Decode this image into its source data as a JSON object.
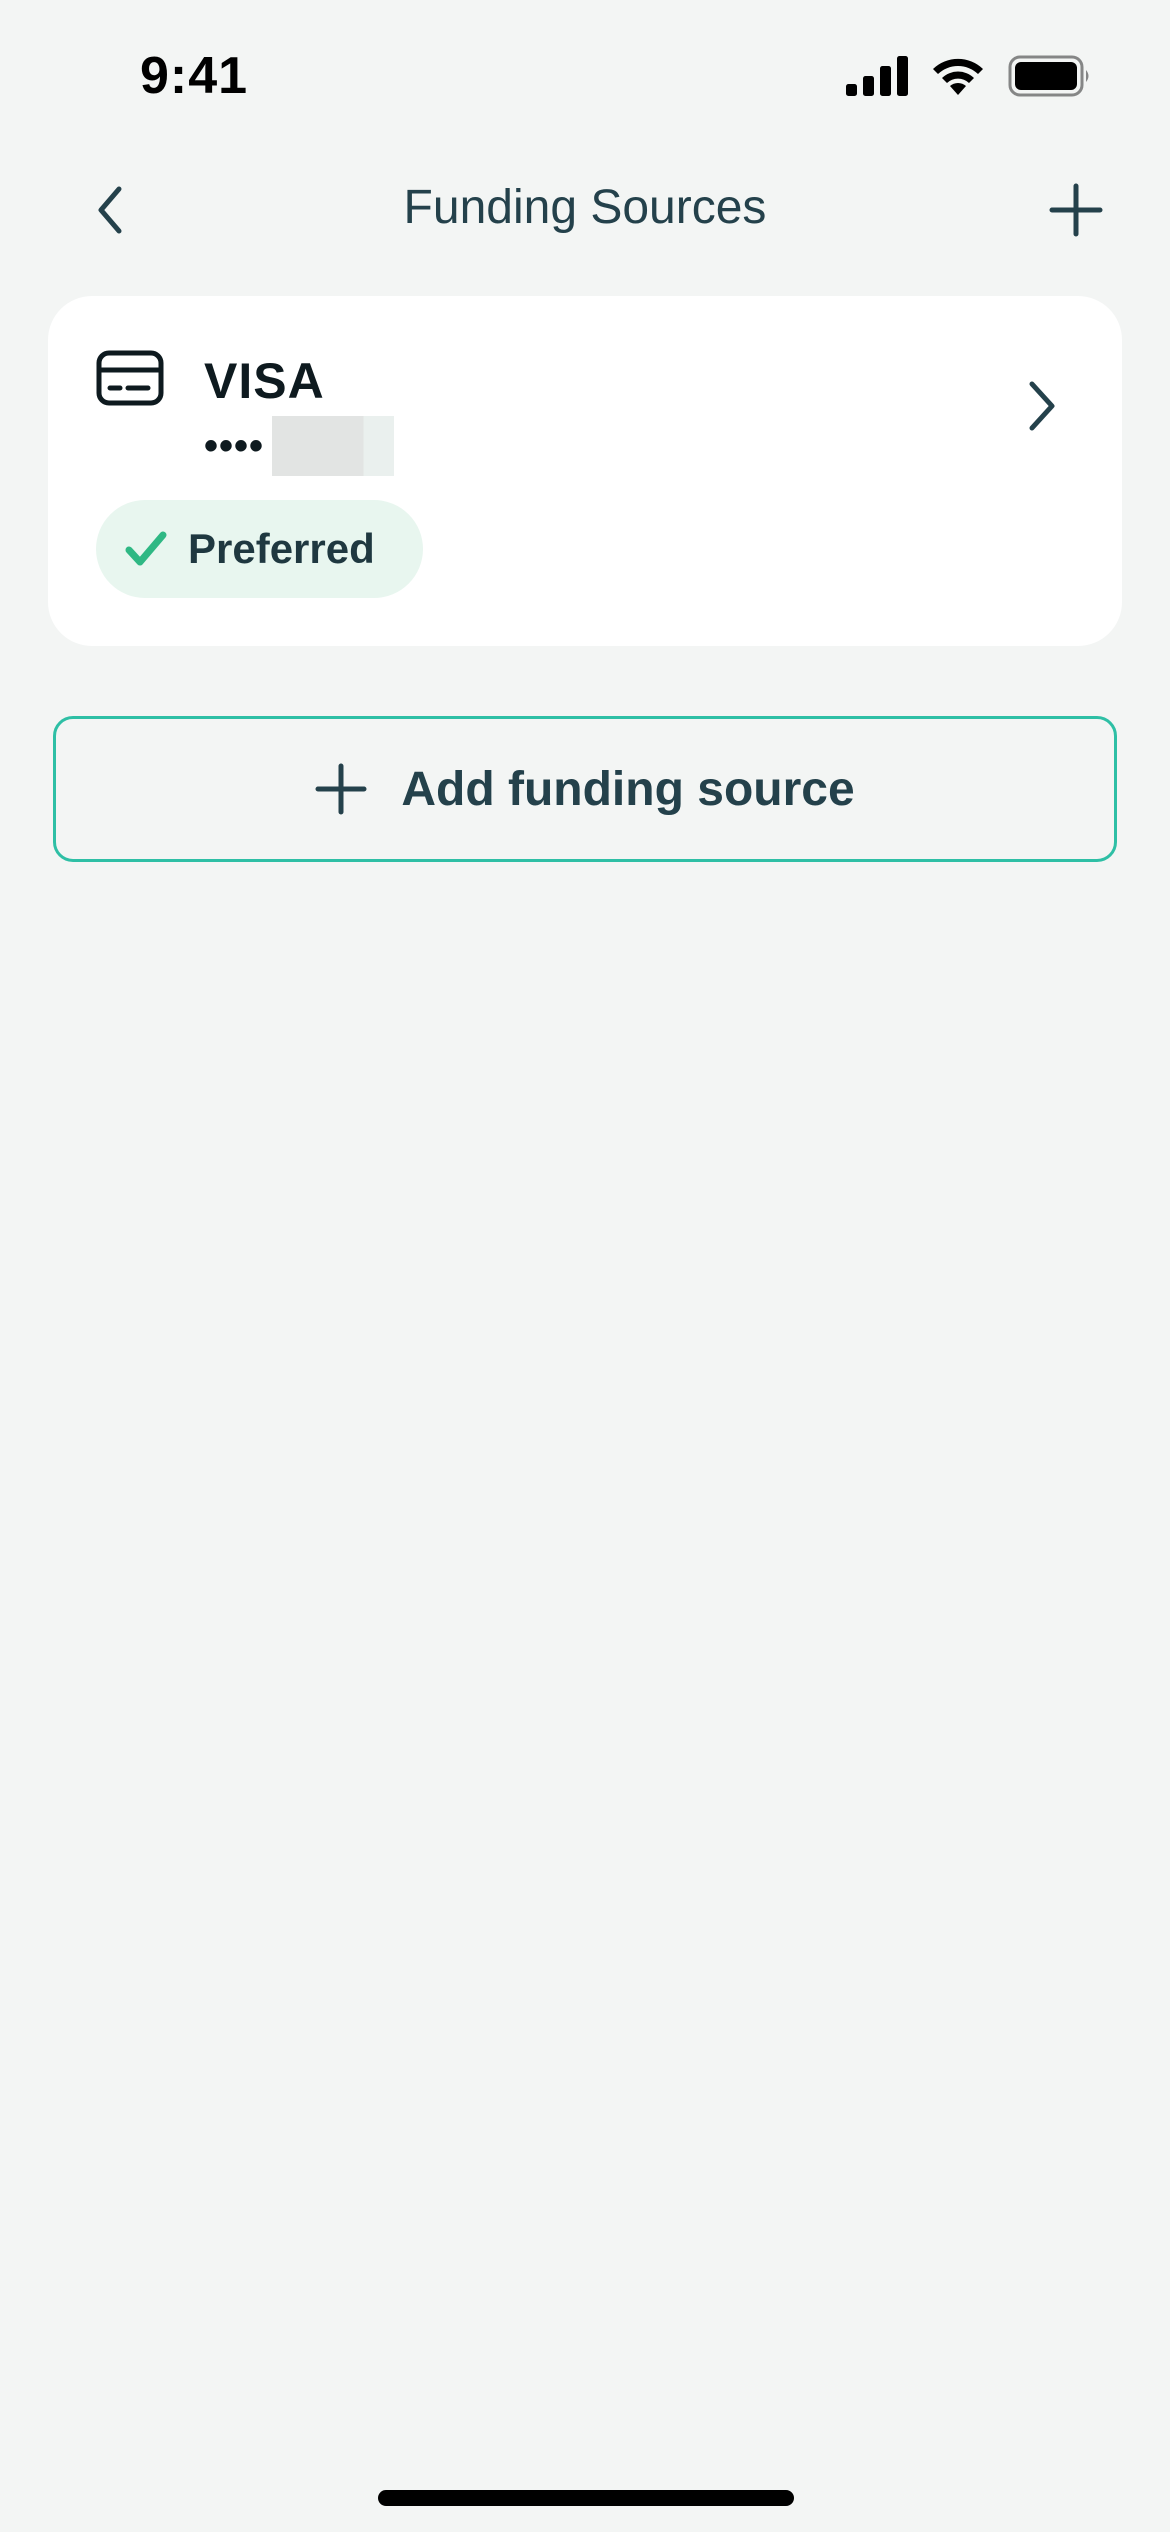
{
  "status_bar": {
    "time": "9:41",
    "icons": [
      "cellular-signal-icon",
      "wifi-icon",
      "battery-icon"
    ]
  },
  "nav": {
    "back_icon": "chevron-left-icon",
    "title": "Funding Sources",
    "add_icon": "plus-icon"
  },
  "funding_sources": [
    {
      "brand": "VISA",
      "masked_prefix": "••••",
      "icon": "credit-card-icon",
      "badge": {
        "label": "Preferred",
        "icon": "checkmark-icon"
      }
    }
  ],
  "add_button": {
    "label": "Add funding source",
    "icon": "plus-icon"
  },
  "colors": {
    "background": "#f3f5f4",
    "card": "#ffffff",
    "accent": "#2ebfa5",
    "check": "#2fb884",
    "badge_bg": "#e8f6ef",
    "text_primary": "#24414b"
  }
}
